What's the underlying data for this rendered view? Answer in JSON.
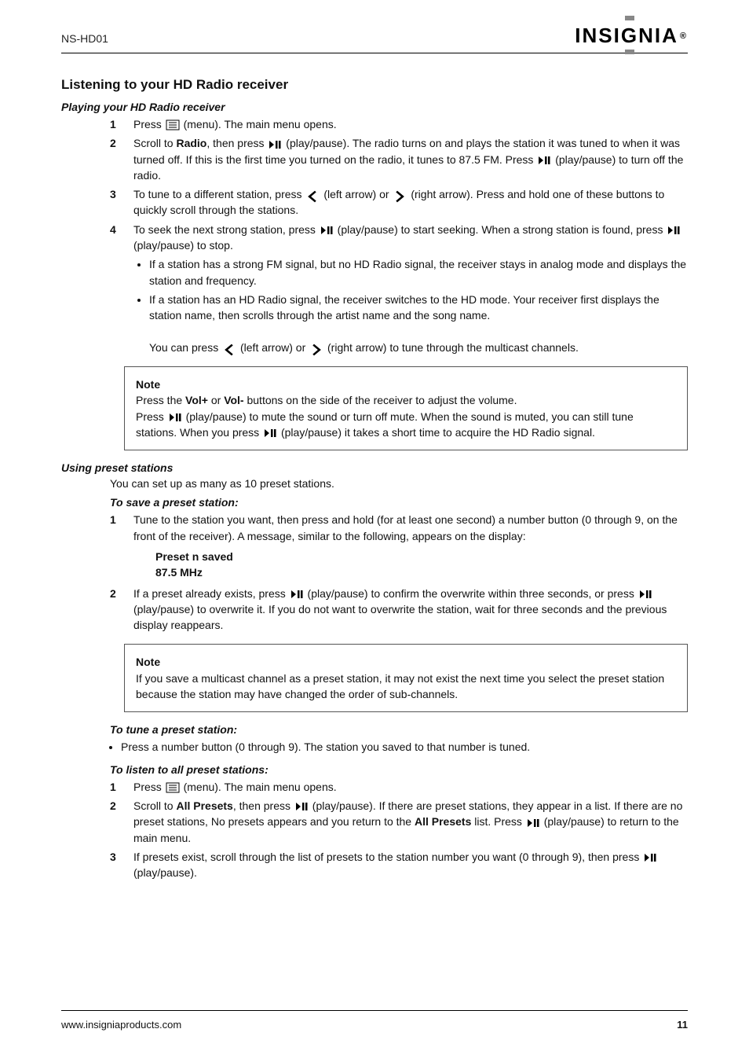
{
  "header": {
    "model": "NS-HD01"
  },
  "logo": {
    "text_before_g": "INSI",
    "g": "G",
    "text_after_g": "NIA",
    "reg": "®"
  },
  "section": {
    "title": "Listening to your HD Radio receiver",
    "sub_play": {
      "title": "Playing your HD Radio receiver"
    },
    "sub_preset": {
      "title": "Using preset stations"
    }
  },
  "play": {
    "step1a": "Press ",
    "step1b": " (menu). The main menu opens.",
    "step2a": "Scroll to ",
    "step2b": "Radio",
    "step2c": ", then press ",
    "step2d": " (play/pause). The radio turns on and plays the station it was tuned to when it was turned off. If this is the first time you turned on the radio, it tunes to 87.5 FM. Press ",
    "step2e": " (play/pause) to turn off the radio.",
    "step3a": "To tune to a different station, press ",
    "step3b": " (left arrow) or ",
    "step3c": " (right arrow). Press and hold one of these buttons to quickly scroll through the stations.",
    "step4a": "To seek the next strong station, press ",
    "step4b": " (play/pause) to start seeking. When a strong station is found, press ",
    "step4c": " (play/pause) to stop.",
    "sub_a": "If a station has a strong FM signal, but no HD Radio signal, the receiver stays in analog mode and displays the station and frequency.",
    "sub_b_1": "If a station has an HD Radio signal, the receiver switches to the HD mode. Your receiver first displays the station name, then scrolls through the artist name and the song name.",
    "sub_b_2": "You can press ",
    "sub_b_3": " (left arrow) or ",
    "sub_b_4": " (right arrow) to tune through the multicast channels."
  },
  "note1": {
    "label": "Note",
    "text_a": "Press the ",
    "text_b": "Vol+",
    "text_c": " or ",
    "text_d": "Vol-",
    "text_e": " buttons on the side of the receiver to adjust the volume.",
    "text2_a": "Press ",
    "text2_b": " (play/pause) to mute the sound or turn off mute. When the sound is muted, you can still tune stations. When you press ",
    "text2_c": " (play/pause) it takes a short time to acquire the HD Radio signal."
  },
  "preset": {
    "intro": "You can set up as many as 10 preset stations.",
    "save_heading": "To save a preset station:",
    "save_step1_a": "Tune to the station you want, then press and hold (for at least one second) a number button (0 through 9, on the front of the receiver). A message, similar to the following, appears on the display:",
    "save_msg_line1": "Preset n saved",
    "save_msg_line2": "87.5 MHz",
    "save_step2_a": "If a preset already exists, press ",
    "save_step2_b": " (play/pause) to confirm the overwrite within three seconds, or press ",
    "save_step2_c": " (play/pause) to overwrite it. If you do not want to overwrite the station, wait for three seconds and the previous display reappears."
  },
  "note2": {
    "label": "Note",
    "text": "If you save a multicast channel as a preset station, it may not exist the next time you select the preset station because the station may have changed the order of sub-channels."
  },
  "tune_heading": "To tune a preset station:",
  "tune_step_a": "Press a number button (0 through 9). The station you saved to that number is tuned.",
  "listen_heading": "To listen to all preset stations:",
  "listen_step1_a": "Press ",
  "listen_step1_b": " (menu). The main menu opens.",
  "listen_step2_a": "Scroll to ",
  "listen_step2_b": "All Presets",
  "listen_step2_c": ", then press ",
  "listen_step2_d": " (play/pause). If there are preset stations, they appear in a list. If there are no preset stations, No presets appears and you return to the ",
  "listen_step2_e": " list. Press ",
  "listen_step2_f": " (play/pause) to return to the main menu.",
  "listen_step3_a": "If presets exist, scroll through the list of presets to the station number you want (0 through 9), then press ",
  "listen_step3_b": " (play/pause).",
  "footer": {
    "site": "www.insigniaproducts.com",
    "page": "11"
  },
  "icons": {
    "menu": "menu-icon",
    "playpause": "play-pause-icon",
    "left": "chevron-left-icon",
    "right": "chevron-right-icon"
  }
}
